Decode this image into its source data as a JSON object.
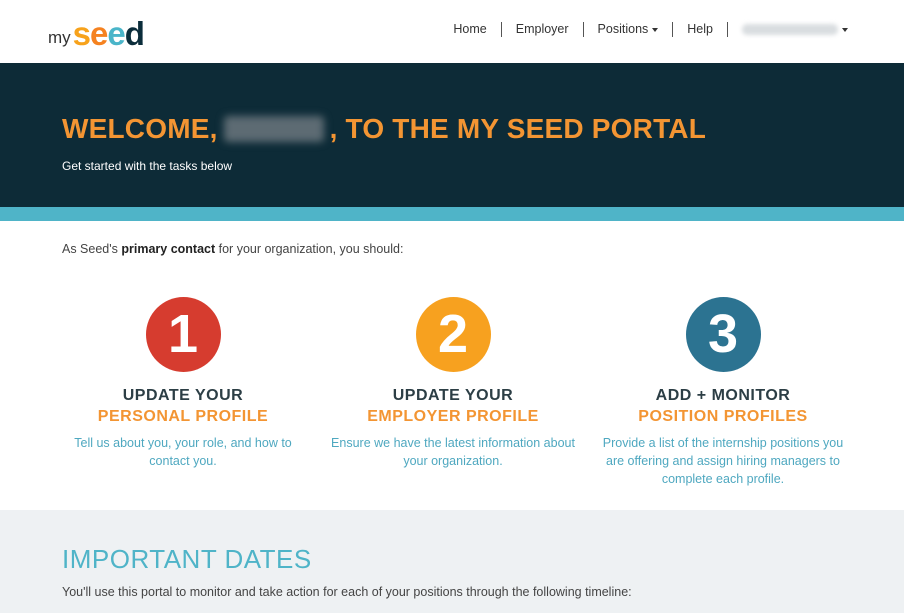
{
  "logo": {
    "my": "my",
    "seed_s": "s",
    "seed_e1": "e",
    "seed_e2": "e",
    "seed_d": "d"
  },
  "nav": {
    "home": "Home",
    "employer": "Employer",
    "positions": "Positions",
    "help": "Help",
    "account": ""
  },
  "hero": {
    "title_prefix": "WELCOME,",
    "title_suffix": ", TO THE MY SEED PORTAL",
    "subtitle": "Get started with the tasks below"
  },
  "intro": {
    "before": "As Seed's ",
    "bold": "primary contact",
    "after": " for your organization, you should:"
  },
  "steps": [
    {
      "number": "1",
      "color": "#d63c2f",
      "line1": "UPDATE YOUR",
      "line2": "PERSONAL PROFILE",
      "desc": "Tell us about you, your role, and how to contact you."
    },
    {
      "number": "2",
      "color": "#f7a11f",
      "line1": "UPDATE YOUR",
      "line2": "EMPLOYER PROFILE",
      "desc": "Ensure we have the latest information about your organization."
    },
    {
      "number": "3",
      "color": "#2c7391",
      "line1": "ADD + MONITOR",
      "line2": "POSITION PROFILES",
      "desc": "Provide a list of the internship positions you are offering and assign hiring managers to complete each profile."
    }
  ],
  "dates": {
    "title": "IMPORTANT DATES",
    "text": "You'll use this portal to monitor and take action for each of your positions through the following timeline:"
  },
  "colors": {
    "hero_bg": "#0d2b37",
    "accent_orange": "#f39533",
    "accent_teal": "#4fb4c8"
  }
}
